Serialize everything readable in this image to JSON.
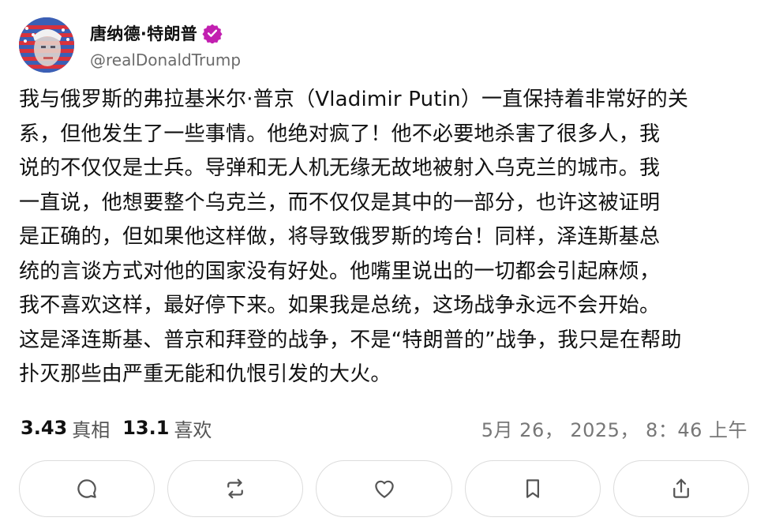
{
  "author": {
    "name": "唐纳德·特朗普",
    "handle": "@realDonaldTrump",
    "verified_color": "#c21fb0"
  },
  "post": {
    "lines": [
      "我与俄罗斯的弗拉基米尔·普京（Vladimir Putin）一直保持着非常好的关",
      "系，但他发生了一些事情。他绝对疯了！他不必要地杀害了很多人，我",
      "说的不仅仅是士兵。导弹和无人机无缘无故地被射入乌克兰的城市。我",
      "一直说，他想要整个乌克兰，而不仅仅是其中的一部分，也许这被证明",
      "是正确的，但如果他这样做，将导致俄罗斯的垮台！同样，泽连斯基总",
      "统的言谈方式对他的国家没有好处。他嘴里说出的一切都会引起麻烦，",
      "我不喜欢这样，最好停下来。如果我是总统，这场战争永远不会开始。",
      "这是泽连斯基、普京和拜登的战争，不是“特朗普的”战争，我只是在帮助",
      "扑灭那些由严重无能和仇恨引发的大火。"
    ]
  },
  "stats": {
    "retruths_count": "3.43",
    "retruths_label": "真相",
    "likes_count": "13.1",
    "likes_label": "喜欢",
    "timestamp": "5月 26， 2025， 8：46 上午"
  },
  "actions": [
    {
      "icon": "reply-icon"
    },
    {
      "icon": "retruth-icon"
    },
    {
      "icon": "heart-icon"
    },
    {
      "icon": "bookmark-icon"
    },
    {
      "icon": "share-icon"
    }
  ]
}
